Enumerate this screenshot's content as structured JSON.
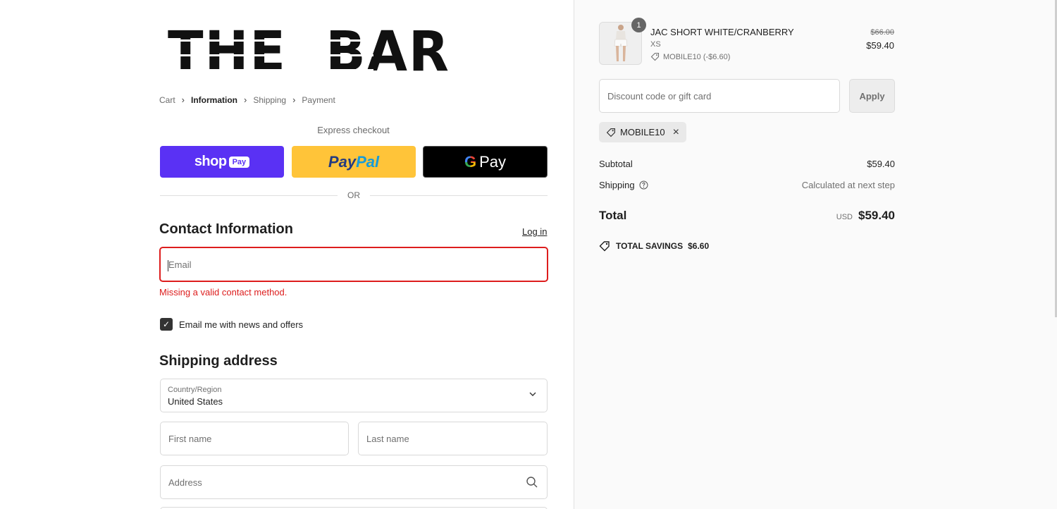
{
  "store": {
    "logo_text": "THE  BAR"
  },
  "breadcrumb": [
    {
      "label": "Cart"
    },
    {
      "label": "Information"
    },
    {
      "label": "Shipping"
    },
    {
      "label": "Payment"
    }
  ],
  "express": {
    "label": "Express checkout",
    "shop_word": "shop",
    "shop_pill": "Pay",
    "paypal_a": "Pay",
    "paypal_b": "Pal",
    "gpay_g": "G",
    "gpay_word": "Pay",
    "or": "OR"
  },
  "contact": {
    "title": "Contact Information",
    "login": "Log in",
    "email_placeholder": "Email",
    "error": "Missing a valid contact method.",
    "newsletter_label": "Email me with news and offers",
    "newsletter_checked": true
  },
  "shipping": {
    "title": "Shipping address",
    "country_label": "Country/Region",
    "country_value": "United States",
    "first_name_placeholder": "First name",
    "last_name_placeholder": "Last name",
    "address_placeholder": "Address"
  },
  "order": {
    "item": {
      "quantity": "1",
      "name": "JAC SHORT WHITE/CRANBERRY",
      "variant": "XS",
      "discount": "MOBILE10 (-$6.60)",
      "price_original": "$66.00",
      "price_final": "$59.40"
    },
    "discount_placeholder": "Discount code or gift card",
    "apply": "Apply",
    "applied_code": "MOBILE10",
    "subtotal_label": "Subtotal",
    "subtotal_value": "$59.40",
    "shipping_label": "Shipping",
    "shipping_value": "Calculated at next step",
    "total_label": "Total",
    "currency": "USD",
    "total_value": "$59.40",
    "savings_label": "TOTAL SAVINGS",
    "savings_value": "$6.60"
  },
  "colors": {
    "shop_pay": "#5a31f4",
    "paypal": "#ffc439",
    "error": "#dd1d1d"
  }
}
